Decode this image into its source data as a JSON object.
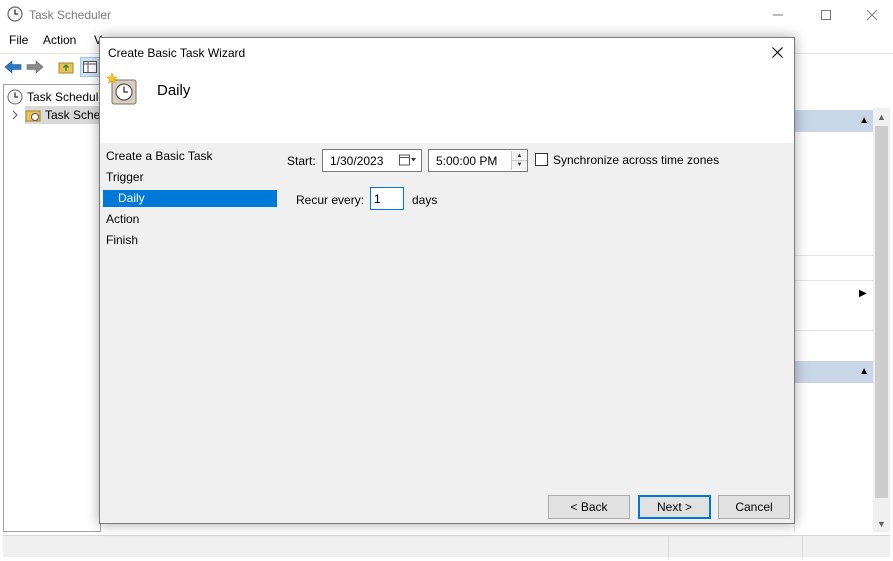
{
  "main_window": {
    "title": "Task Scheduler",
    "menu": [
      "File",
      "Action",
      "V"
    ],
    "tree": [
      {
        "label": "Task Scheduler (Local)"
      },
      {
        "label": "Task Scheduler Library"
      }
    ]
  },
  "dialog": {
    "title": "Create Basic Task Wizard",
    "header_title": "Daily",
    "steps": [
      "Create a Basic Task",
      "Trigger",
      "Daily",
      "Action",
      "Finish"
    ],
    "current_step": "Daily",
    "start_label": "Start:",
    "start_date": "1/30/2023",
    "start_time": "5:00:00 PM",
    "sync_label": "Synchronize across time zones",
    "sync_checked": false,
    "recur_label": "Recur every:",
    "recur_value": "1",
    "recur_unit": "days",
    "buttons": {
      "back": "< Back",
      "next": "Next >",
      "cancel": "Cancel"
    }
  },
  "colors": {
    "accent": "#0078d7",
    "dialog_bg": "#f0f0f0",
    "header_strip": "#c9d6e8"
  },
  "icons": [
    "clock-icon",
    "back-arrow-icon",
    "forward-arrow-icon",
    "folder-up-icon",
    "console-tree-icon",
    "calendar-icon",
    "close-icon",
    "wizard-clock-icon"
  ]
}
